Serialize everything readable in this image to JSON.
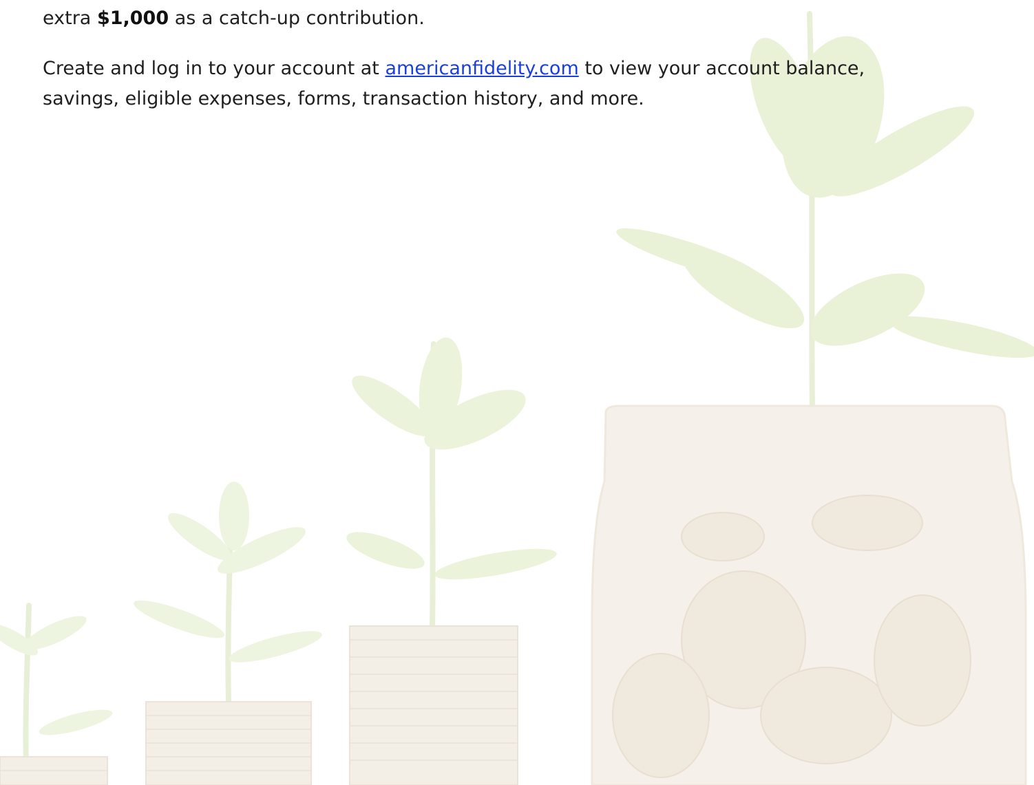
{
  "paragraph_1": {
    "prefix": "extra ",
    "amount": "$1,000",
    "suffix": " as a catch-up contribution."
  },
  "paragraph_2": {
    "line_1_prefix": "Create and log in to your account at ",
    "link_text": "americanfidelity.com",
    "line_1_suffix": " to view your account balance,",
    "line_2": "savings, eligible expenses, forms, transaction history, and more."
  },
  "background": {
    "description_icon": "plants-growing-from-coin-stacks-and-jar-illustration",
    "leaf_color": "#dfeec0",
    "coin_color": "#f1ebe2"
  }
}
